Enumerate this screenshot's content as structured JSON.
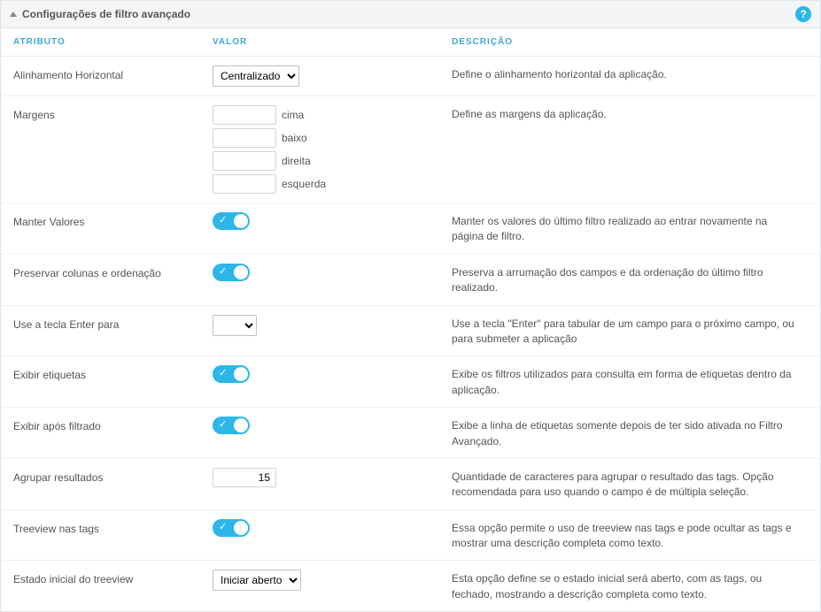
{
  "panel": {
    "title": "Configurações de filtro avançado"
  },
  "headers": {
    "attr": "ATRIBUTO",
    "val": "VALOR",
    "desc": "DESCRIÇÃO"
  },
  "rows": {
    "halign": {
      "label": "Alinhamento Horizontal",
      "value": "Centralizado",
      "desc": "Define o alinhamento horizontal da aplicação."
    },
    "margins": {
      "label": "Margens",
      "top_label": "cima",
      "bottom_label": "baixo",
      "right_label": "direita",
      "left_label": "esquerda",
      "desc": "Define as margens da aplicação."
    },
    "keep_values": {
      "label": "Manter Valores",
      "desc": "Manter os valores do último filtro realizado ao entrar novamente na página de filtro."
    },
    "preserve": {
      "label": "Preservar colunas e ordenação",
      "desc": "Preserva a arrumação dos campos e da ordenação do último filtro realizado."
    },
    "enter_key": {
      "label": "Use a tecla Enter para",
      "value": "",
      "desc": "Use a tecla \"Enter\" para tabular de um campo para o próximo campo, ou para submeter a aplicação"
    },
    "show_tags": {
      "label": "Exibir etiquetas",
      "desc": "Exibe os filtros utilizados para consulta em forma de etiquetas dentro da aplicação."
    },
    "show_after": {
      "label": "Exibir após filtrado",
      "desc": "Exibe a linha de etiquetas somente depois de ter sido ativada no Filtro Avançado."
    },
    "group_results": {
      "label": "Agrupar resultados",
      "value": "15",
      "desc": "Quantidade de caracteres para agrupar o resultado das tags. Opção recomendada para uso quando o campo é de múltipla seleção."
    },
    "treeview": {
      "label": "Treeview nas tags",
      "desc": "Essa opção permite o uso de treeview nas tags e pode ocultar as tags e mostrar uma descrição completa como texto."
    },
    "treeview_state": {
      "label": "Estado inicial do treeview",
      "value": "Iniciar aberto",
      "desc": "Esta opção define se o estado inicial será aberto, com as tags, ou fechado, mostrando a descrição completa como texto."
    }
  }
}
